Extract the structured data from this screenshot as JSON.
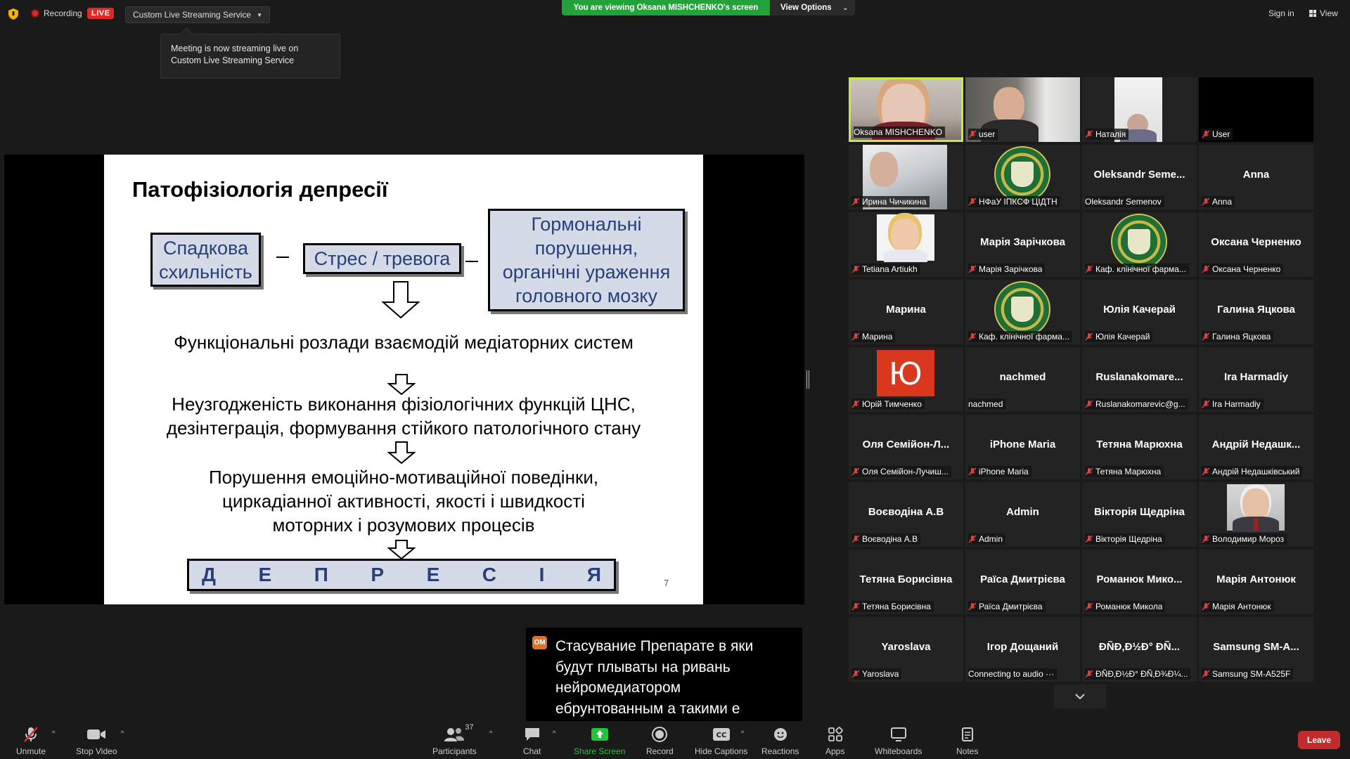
{
  "topbar": {
    "recording_label": "Recording",
    "live_label": "LIVE",
    "stream_service": "Custom Live Streaming Service",
    "tooltip": "Meeting is now streaming live on Custom Live Streaming Service",
    "viewing_banner": "You are viewing Oksana MISHCHENKO's screen",
    "view_options": "View Options",
    "sign_in": "Sign in",
    "view": "View"
  },
  "slide": {
    "title": "Патофізіологія депресії",
    "box1_l1": "Спадкова",
    "box1_l2": "схильність",
    "box2": "Стрес / тревога",
    "box3_l1": "Гормональні",
    "box3_l2": "порушення,",
    "box3_l3": "органічні ураження",
    "box3_l4": "головного мозку",
    "text1": "Функціональні розлади взаємодій медіаторних систем",
    "text2_l1": "Неузгодженість виконання фізіологічних функцій ЦНС,",
    "text2_l2": "дезінтеграція, формування стійкого патологічного стану",
    "text3_l1": "Порушення емоційно-мотиваційної поведінки,",
    "text3_l2": "циркадіанної активності, якості і швидкості",
    "text3_l3": "моторних і розумових процесів",
    "dep_letters": [
      "Д",
      "Е",
      "П",
      "Р",
      "Е",
      "С",
      "І",
      "Я"
    ],
    "page_number": "7"
  },
  "gallery": [
    {
      "label": "Oksana MISHCHENKO",
      "big": "",
      "muted": false,
      "kind": "photo-woman",
      "active": true
    },
    {
      "label": "user",
      "big": "",
      "muted": true,
      "kind": "photo-man"
    },
    {
      "label": "Наталія",
      "big": "",
      "muted": true,
      "kind": "photo-nat"
    },
    {
      "label": "User",
      "big": "",
      "muted": true,
      "kind": "black"
    },
    {
      "label": "Ирина Чичикина",
      "big": "",
      "muted": true,
      "kind": "photo-iryna"
    },
    {
      "label": "НФаУ ІПКСФ ЦІДТН",
      "big": "",
      "muted": true,
      "kind": "logo"
    },
    {
      "label": "Oleksandr Semenov",
      "big": "Oleksandr Seme...",
      "muted": false,
      "kind": "name"
    },
    {
      "label": "Anna",
      "big": "Anna",
      "muted": true,
      "kind": "name"
    },
    {
      "label": "Tetiana Artiukh",
      "big": "",
      "muted": true,
      "kind": "photo-tetiana"
    },
    {
      "label": "Марія Зарічкова",
      "big": "Марія Зарічкова",
      "muted": true,
      "kind": "name"
    },
    {
      "label": "Каф. клінічної фарма...",
      "big": "",
      "muted": true,
      "kind": "logo"
    },
    {
      "label": "Оксана Черненко",
      "big": "Оксана Черненко",
      "muted": true,
      "kind": "name"
    },
    {
      "label": "Марина",
      "big": "Марина",
      "muted": true,
      "kind": "name"
    },
    {
      "label": "Каф. клінічної фарма...",
      "big": "",
      "muted": true,
      "kind": "logo"
    },
    {
      "label": "Юлія Качерай",
      "big": "Юлія Качерай",
      "muted": true,
      "kind": "name"
    },
    {
      "label": "Галина Яцкова",
      "big": "Галина Яцкова",
      "muted": true,
      "kind": "name"
    },
    {
      "label": "Юрій Тимченко",
      "big": "",
      "muted": true,
      "kind": "avatar-yu",
      "avatar_letter": "Ю"
    },
    {
      "label": "nachmed",
      "big": "nachmed",
      "muted": false,
      "kind": "name"
    },
    {
      "label": "Ruslanakomarevic@g...",
      "big": "Ruslanakomare...",
      "muted": true,
      "kind": "name"
    },
    {
      "label": "Ira Harmadiy",
      "big": "Ira Harmadiy",
      "muted": true,
      "kind": "name"
    },
    {
      "label": "Оля Семійон-Лучиш...",
      "big": "Оля Семійон-Л...",
      "muted": true,
      "kind": "name"
    },
    {
      "label": "iPhone Maria",
      "big": "iPhone Maria",
      "muted": true,
      "kind": "name"
    },
    {
      "label": "Тетяна Марюхна",
      "big": "Тетяна Марюхна",
      "muted": true,
      "kind": "name"
    },
    {
      "label": "Андрій Недашківський",
      "big": "Андрій  Недашк...",
      "muted": true,
      "kind": "name"
    },
    {
      "label": "Воєводіна А.В",
      "big": "Воєводіна А.В",
      "muted": true,
      "kind": "name"
    },
    {
      "label": "Admin",
      "big": "Admin",
      "muted": true,
      "kind": "name"
    },
    {
      "label": "Вікторія Щедріна",
      "big": "Вікторія Щедріна",
      "muted": true,
      "kind": "name"
    },
    {
      "label": "Володимир Мороз",
      "big": "",
      "muted": true,
      "kind": "photo-volodymyr"
    },
    {
      "label": "Тетяна Борисівна",
      "big": "Тетяна Борисівна",
      "muted": true,
      "kind": "name"
    },
    {
      "label": "Раїса Дмитрієва",
      "big": "Раїса Дмитрієва",
      "muted": true,
      "kind": "name"
    },
    {
      "label": "Романюк Микола",
      "big": "Романюк  Мико...",
      "muted": true,
      "kind": "name"
    },
    {
      "label": "Марія Антонюк",
      "big": "Марія Антонюк",
      "muted": true,
      "kind": "name"
    },
    {
      "label": "Yaroslava",
      "big": "Yaroslava",
      "muted": true,
      "kind": "name"
    },
    {
      "label": "Connecting to audio ···",
      "big": "Ігор Дощаний",
      "muted": false,
      "kind": "name"
    },
    {
      "label": "ÐÑÐ‚Ð½Ð° ÐÑ‚Ð¾Ð¼...",
      "big": "ÐÑÐ‚Ð½Ð° ÐÑ...",
      "muted": true,
      "kind": "name"
    },
    {
      "label": "Samsung SM-A525F",
      "big": "Samsung  SM-A...",
      "muted": true,
      "kind": "name"
    }
  ],
  "caption": {
    "badge": "OM",
    "text": "Стасувание Препарате в яки будут плываты на ривань нейромедиатором ебрунтованным а такими е"
  },
  "toolbar": {
    "unmute": "Unmute",
    "stop_video": "Stop Video",
    "participants": "Participants",
    "participants_count": "37",
    "chat": "Chat",
    "share_screen": "Share Screen",
    "record": "Record",
    "hide_captions": "Hide Captions",
    "reactions": "Reactions",
    "apps": "Apps",
    "whiteboards": "Whiteboards",
    "notes": "Notes",
    "leave": "Leave"
  },
  "colors": {
    "live_red": "#e02828",
    "banner_green": "#23a23a",
    "active_speaker": "#c7e84a",
    "slide_box_fill": "#d4dae6",
    "slide_box_text": "#2a3f7a",
    "leave_red": "#c22b2b"
  }
}
